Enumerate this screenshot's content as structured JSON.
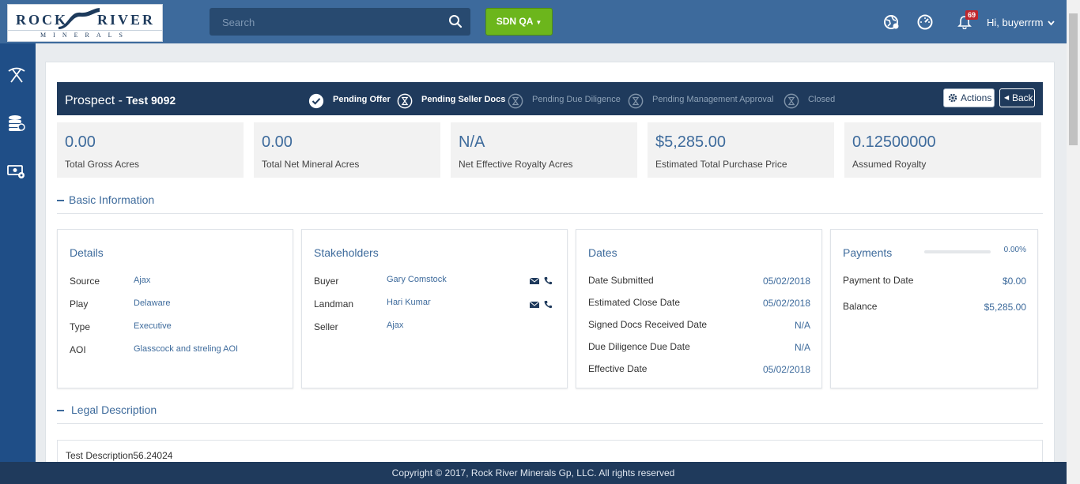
{
  "logo": {
    "word_left": "ROCK",
    "word_right": "RIVER",
    "subtitle": "MINERALS"
  },
  "search": {
    "placeholder": "Search"
  },
  "environment": {
    "label": "SDN QA"
  },
  "notifications": {
    "count": "69"
  },
  "user": {
    "greeting": "Hi, buyerrrm"
  },
  "sidebar": {
    "items": [
      {
        "icon": "pickaxe-icon"
      },
      {
        "icon": "coins-icon"
      },
      {
        "icon": "money-settings-icon"
      }
    ]
  },
  "header": {
    "title_prefix": "Prospect -",
    "title_name": "Test 9092",
    "steps": [
      {
        "label": "Pending Offer",
        "state": "done"
      },
      {
        "label": "Pending Seller Docs",
        "state": "active"
      },
      {
        "label": "Pending Due Diligence",
        "state": "pending"
      },
      {
        "label": "Pending Management Approval",
        "state": "pending"
      },
      {
        "label": "Closed",
        "state": "pending"
      }
    ],
    "actions_label": "Actions",
    "back_label": "Back"
  },
  "stats": [
    {
      "value": "0.00",
      "label": "Total Gross Acres"
    },
    {
      "value": "0.00",
      "label": "Total Net Mineral Acres"
    },
    {
      "value": "N/A",
      "label": "Net Effective Royalty Acres"
    },
    {
      "value": "$5,285.00",
      "label": "Estimated Total Purchase Price"
    },
    {
      "value": "0.12500000",
      "label": "Assumed Royalty"
    }
  ],
  "sections": {
    "basic": "Basic Information",
    "legal": "Legal Description"
  },
  "details": {
    "title": "Details",
    "rows": [
      {
        "label": "Source",
        "value": "Ajax"
      },
      {
        "label": "Play",
        "value": "Delaware"
      },
      {
        "label": "Type",
        "value": "Executive"
      },
      {
        "label": "AOI",
        "value": "Glasscock and streling AOI"
      }
    ]
  },
  "stakeholders": {
    "title": "Stakeholders",
    "rows": [
      {
        "label": "Buyer",
        "value": "Gary Comstock"
      },
      {
        "label": "Landman",
        "value": "Hari Kumar"
      },
      {
        "label": "Seller",
        "value": "Ajax"
      }
    ]
  },
  "dates": {
    "title": "Dates",
    "rows": [
      {
        "label": "Date Submitted",
        "value": "05/02/2018"
      },
      {
        "label": "Estimated Close Date",
        "value": "05/02/2018"
      },
      {
        "label": "Signed Docs Received Date",
        "value": "N/A"
      },
      {
        "label": "Due Diligence Due Date",
        "value": "N/A"
      },
      {
        "label": "Effective Date",
        "value": "05/02/2018"
      }
    ]
  },
  "payments": {
    "title": "Payments",
    "progress_text": "0.00%",
    "progress_fraction": 0,
    "rows": [
      {
        "label": "Payment to Date",
        "value": "$0.00"
      },
      {
        "label": "Balance",
        "value": "$5,285.00"
      }
    ]
  },
  "legal": {
    "text": "Test Description56.24024"
  },
  "footer": {
    "text": "Copyright © 2017, Rock River Minerals Gp, LLC. All rights reserved"
  },
  "colors": {
    "header": "#1f3a5c",
    "topbar": "#3d6a9c",
    "accent": "#3e6b9c",
    "env_button": "#6cb61c",
    "badge": "#c0272d"
  }
}
